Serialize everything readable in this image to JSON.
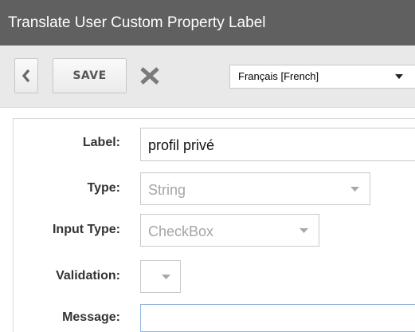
{
  "window": {
    "title": "Translate User Custom Property Label"
  },
  "toolbar": {
    "back_icon": "chevron-left-icon",
    "save_label": "SAVE",
    "cancel_icon": "close-x-icon",
    "language_selected": "Français [French]"
  },
  "form": {
    "label": {
      "caption": "Label:",
      "value": "profil  privé"
    },
    "type": {
      "caption": "Type:",
      "value": "String"
    },
    "input_type": {
      "caption": "Input Type:",
      "value": "CheckBox"
    },
    "validation": {
      "caption": "Validation:",
      "value": ""
    },
    "message": {
      "caption": "Message:",
      "value": ""
    }
  },
  "colors": {
    "titlebar_bg": "#606060",
    "toolbar_bg": "#e9e9e9",
    "disabled_text": "#a6a6a6",
    "focus_border": "#8fb6dc"
  }
}
